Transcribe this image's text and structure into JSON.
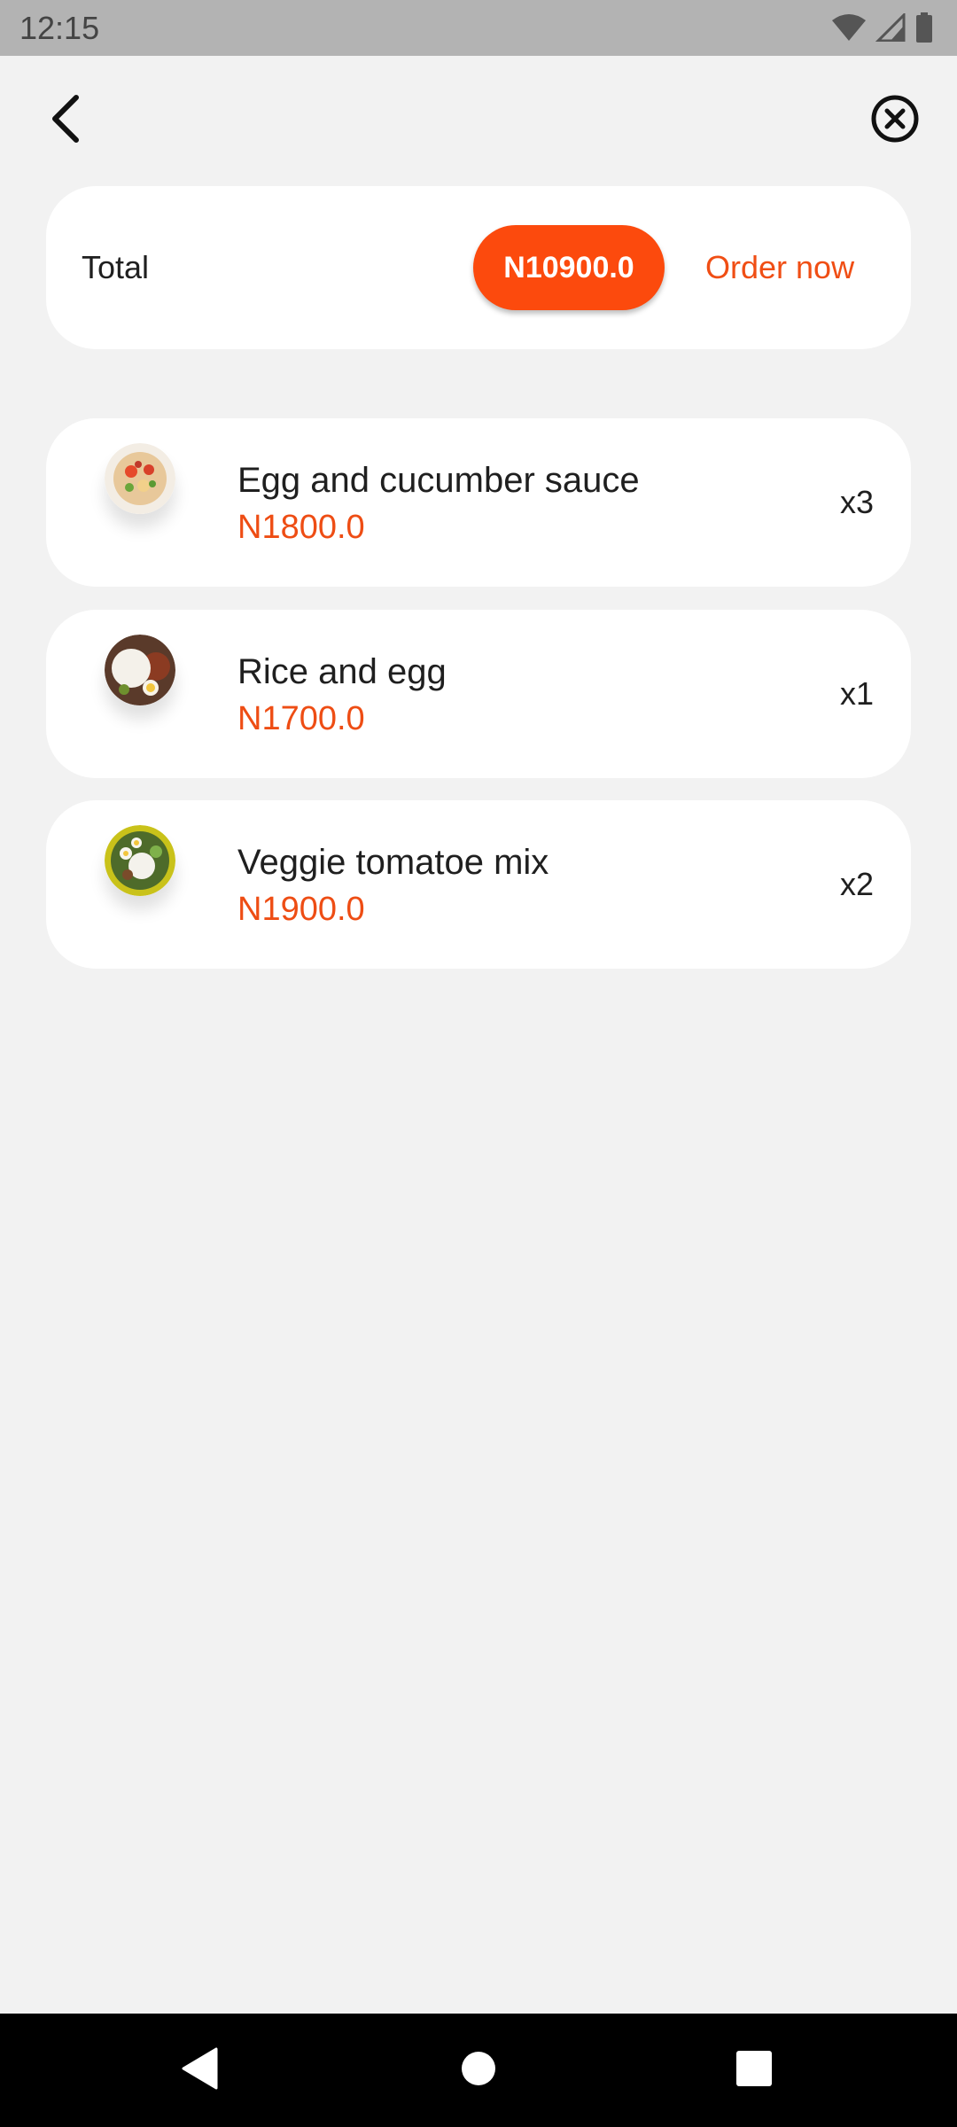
{
  "status_bar": {
    "time": "12:15",
    "icons": [
      "wifi-icon",
      "cell-signal-icon",
      "battery-icon"
    ]
  },
  "nav": {
    "back_icon": "back-arrow-icon",
    "close_icon": "close-circle-icon"
  },
  "summary": {
    "total_label": "Total",
    "total_amount": "N10900.0",
    "order_now_label": "Order now"
  },
  "items": [
    {
      "name": "Egg and cucumber sauce",
      "price": "N1800.0",
      "quantity": "x3"
    },
    {
      "name": "Rice and egg",
      "price": "N1700.0",
      "quantity": "x1"
    },
    {
      "name": "Veggie tomatoe mix",
      "price": "N1900.0",
      "quantity": "x2"
    }
  ],
  "system_nav": {
    "icons": [
      "back-triangle-icon",
      "home-circle-icon",
      "recents-square-icon"
    ]
  },
  "colors": {
    "accent": "#fc4a0d",
    "price_text": "#ee4d14",
    "background": "#f2f2f2",
    "card": "#ffffff"
  }
}
